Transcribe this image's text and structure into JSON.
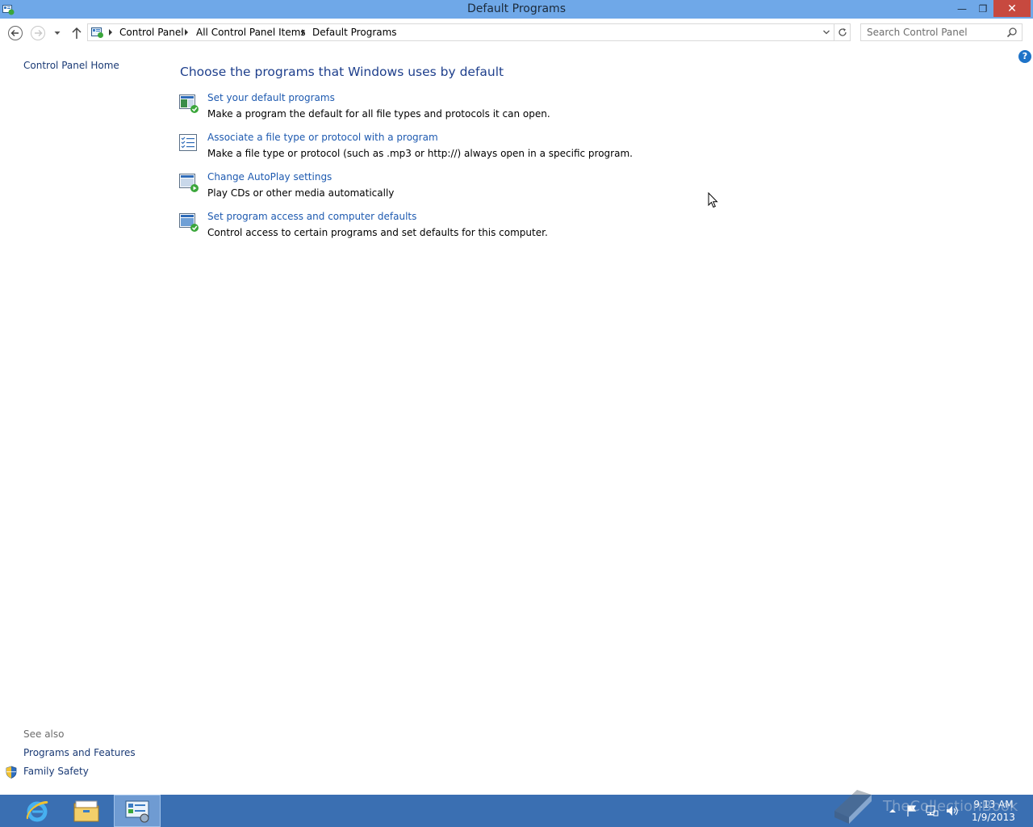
{
  "window": {
    "title": "Default Programs",
    "minimize_glyph": "—",
    "maximize_glyph": "❐",
    "close_glyph": "✕"
  },
  "nav": {
    "breadcrumbs": [
      "Control Panel",
      "All Control Panel Items",
      "Default Programs"
    ],
    "search_placeholder": "Search Control Panel"
  },
  "sidebar": {
    "home_label": "Control Panel Home",
    "see_also_heading": "See also",
    "see_also_links": [
      "Programs and Features",
      "Family Safety"
    ]
  },
  "main": {
    "heading": "Choose the programs that Windows uses by default",
    "tasks": [
      {
        "icon": "default-programs-icon",
        "link": "Set your default programs",
        "description": "Make a program the default for all file types and protocols it can open."
      },
      {
        "icon": "file-association-icon",
        "link": "Associate a file type or protocol with a program",
        "description": "Make a file type or protocol (such as .mp3 or http://) always open in a specific program."
      },
      {
        "icon": "autoplay-icon",
        "link": "Change AutoPlay settings",
        "description": "Play CDs or other media automatically"
      },
      {
        "icon": "program-access-icon",
        "link": "Set program access and computer defaults",
        "description": "Control access to certain programs and set defaults for this computer."
      }
    ]
  },
  "help_glyph": "?",
  "taskbar": {
    "apps": [
      "internet-explorer-icon",
      "file-explorer-icon",
      "control-panel-icon"
    ],
    "clock_time": "9:13 AM",
    "clock_date": "1/9/2013"
  },
  "watermark_text": "TheCollectionBook",
  "colors": {
    "titlebar": "#6fa8e8",
    "close_button": "#c7493f",
    "link": "#1e5ab0",
    "heading": "#1e3f8c",
    "taskbar": "#3a6fb2"
  }
}
